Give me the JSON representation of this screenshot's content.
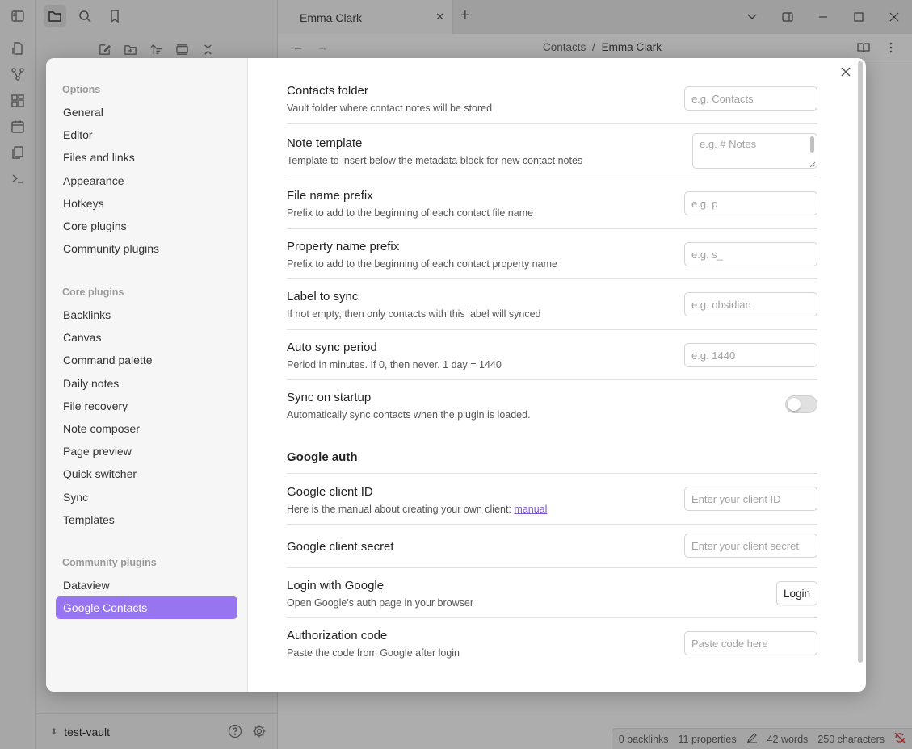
{
  "tab": {
    "title": "Emma Clark"
  },
  "breadcrumb": {
    "folder": "Contacts",
    "separator": "/",
    "note": "Emma Clark"
  },
  "vault": {
    "name": "test-vault"
  },
  "status": {
    "backlinks": "0 backlinks",
    "properties": "11 properties",
    "words": "42 words",
    "characters": "250 characters"
  },
  "sidebar": {
    "options_heading": "Options",
    "options": [
      "General",
      "Editor",
      "Files and links",
      "Appearance",
      "Hotkeys",
      "Core plugins",
      "Community plugins"
    ],
    "core_heading": "Core plugins",
    "core": [
      "Backlinks",
      "Canvas",
      "Command palette",
      "Daily notes",
      "File recovery",
      "Note composer",
      "Page preview",
      "Quick switcher",
      "Sync",
      "Templates"
    ],
    "community_heading": "Community plugins",
    "community": [
      "Dataview",
      "Google Contacts"
    ],
    "selected": "Google Contacts"
  },
  "settings": {
    "contacts_folder": {
      "name": "Contacts folder",
      "desc": "Vault folder where contact notes will be stored",
      "placeholder": "e.g. Contacts",
      "value": ""
    },
    "note_template": {
      "name": "Note template",
      "desc": "Template to insert below the metadata block for new contact notes",
      "placeholder": "e.g. # Notes",
      "value": ""
    },
    "file_prefix": {
      "name": "File name prefix",
      "desc": "Prefix to add to the beginning of each contact file name",
      "placeholder": "e.g. p",
      "value": ""
    },
    "property_prefix": {
      "name": "Property name prefix",
      "desc": "Prefix to add to the beginning of each contact property name",
      "placeholder": "e.g. s_",
      "value": ""
    },
    "label_sync": {
      "name": "Label to sync",
      "desc": "If not empty, then only contacts with this label will synced",
      "placeholder": "e.g. obsidian",
      "value": ""
    },
    "auto_sync": {
      "name": "Auto sync period",
      "desc": "Period in minutes. If 0, then never. 1 day = 1440",
      "placeholder": "e.g. 1440",
      "value": ""
    },
    "sync_startup": {
      "name": "Sync on startup",
      "desc": "Automatically sync contacts when the plugin is loaded.",
      "enabled": false
    },
    "google_auth_heading": "Google auth",
    "client_id": {
      "name": "Google client ID",
      "desc": "Here is the manual about creating your own client: ",
      "link": "manual",
      "placeholder": "Enter your client ID",
      "value": ""
    },
    "client_secret": {
      "name": "Google client secret",
      "placeholder": "Enter your client secret",
      "value": ""
    },
    "login": {
      "name": "Login with Google",
      "desc": "Open Google's auth page in your browser",
      "button": "Login"
    },
    "auth_code": {
      "name": "Authorization code",
      "desc": "Paste the code from Google after login",
      "placeholder": "Paste code here",
      "value": ""
    }
  },
  "colors": {
    "accent": "#9775f0",
    "link": "#7b55d8",
    "sync_error": "#d04545"
  },
  "icons": [
    "sidebar-toggle-icon",
    "folder-icon",
    "search-icon",
    "bookmark-icon",
    "new-note-icon",
    "new-folder-icon",
    "sort-icon",
    "collapse-icon",
    "graph-icon",
    "canvas-icon",
    "calendar-icon",
    "templates-icon",
    "terminal-icon",
    "help-icon",
    "settings-icon",
    "close-icon",
    "reading-view-icon",
    "more-options-icon",
    "pencil-icon",
    "sync-off-icon"
  ]
}
